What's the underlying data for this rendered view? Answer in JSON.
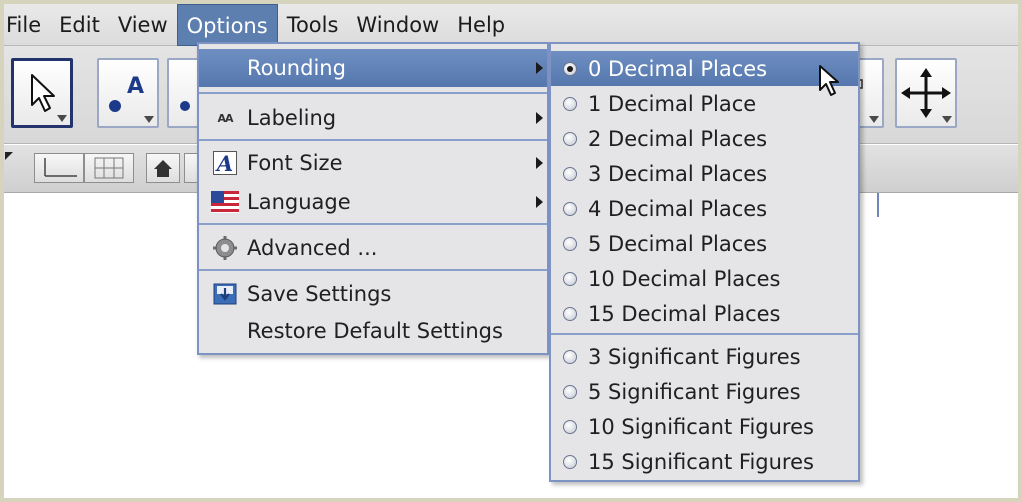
{
  "menubar": {
    "items": [
      {
        "label": "File"
      },
      {
        "label": "Edit"
      },
      {
        "label": "View"
      },
      {
        "label": "Options",
        "active": true
      },
      {
        "label": "Tools"
      },
      {
        "label": "Window"
      },
      {
        "label": "Help"
      }
    ]
  },
  "toolbar": {
    "tools": [
      {
        "icon": "pointer-icon",
        "selected": true
      },
      {
        "icon": "point-icon",
        "text": "A"
      },
      {
        "icon": "line-icon"
      },
      {
        "icon": "slider-icon"
      },
      {
        "icon": "move-graphics-view-icon"
      }
    ]
  },
  "options_menu": {
    "items": [
      {
        "label": "Rounding",
        "icon": "",
        "has_submenu": true,
        "highlighted": true
      },
      {
        "label": "Labeling",
        "icon": "labeling-icon",
        "icon_text": "AA",
        "has_submenu": true
      },
      {
        "label": "Font Size",
        "icon": "font-size-icon",
        "icon_text": "A",
        "has_submenu": true
      },
      {
        "label": "Language",
        "icon": "flag-icon",
        "has_submenu": true
      },
      {
        "label": "Advanced ...",
        "icon": "gear-icon"
      },
      {
        "label": "Save Settings",
        "icon": "save-icon"
      },
      {
        "label": "Restore Default Settings",
        "icon": ""
      }
    ]
  },
  "rounding_submenu": {
    "selected": "0 Decimal Places",
    "items": [
      "0 Decimal Places",
      "1 Decimal Place",
      "2 Decimal Places",
      "3 Decimal Places",
      "4 Decimal Places",
      "5 Decimal Places",
      "10 Decimal Places",
      "15 Decimal Places",
      "3 Significant Figures",
      "5 Significant Figures",
      "10 Significant Figures",
      "15 Significant Figures"
    ]
  },
  "colors": {
    "highlight": "#5d7fb0",
    "menu_bg": "#e5e5e8",
    "menu_border": "#7d93c4",
    "frame": "#d6d4bd"
  }
}
